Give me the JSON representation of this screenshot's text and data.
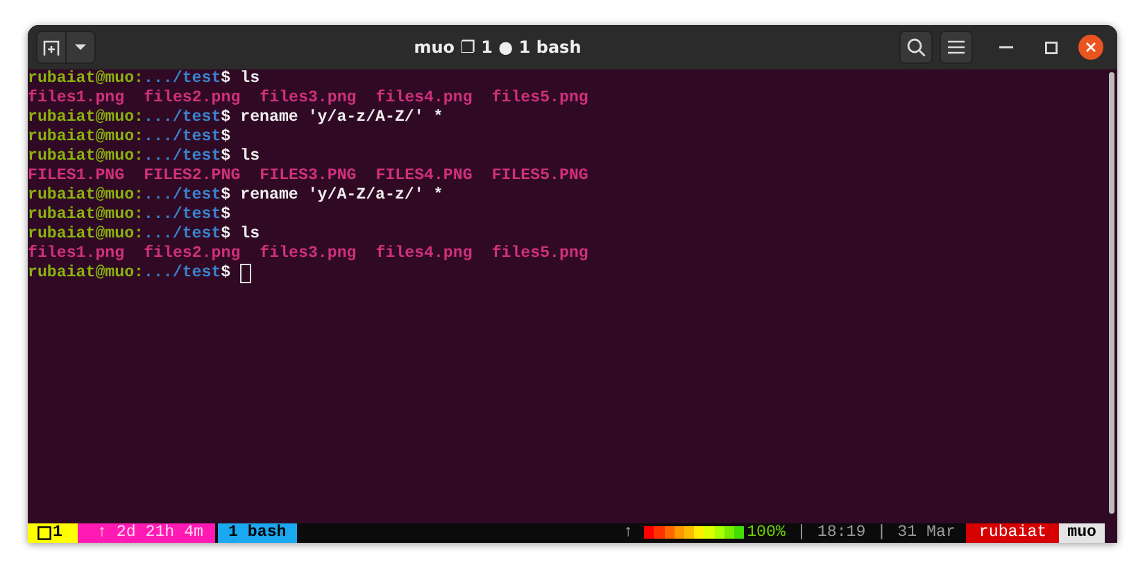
{
  "window": {
    "title": "muo ❐ 1 ● 1 bash"
  },
  "terminal": {
    "lines": [
      {
        "kind": "prompt",
        "user": "rubaiat@muo",
        "sep": ":",
        "path": ".../test",
        "symbol": "$",
        "command": "ls"
      },
      {
        "kind": "output",
        "files": [
          "files1.png",
          "files2.png",
          "files3.png",
          "files4.png",
          "files5.png"
        ]
      },
      {
        "kind": "prompt",
        "user": "rubaiat@muo",
        "sep": ":",
        "path": ".../test",
        "symbol": "$",
        "command": "rename 'y/a-z/A-Z/' *"
      },
      {
        "kind": "prompt",
        "user": "rubaiat@muo",
        "sep": ":",
        "path": ".../test",
        "symbol": "$"
      },
      {
        "kind": "prompt",
        "user": "rubaiat@muo",
        "sep": ":",
        "path": ".../test",
        "symbol": "$",
        "command": "ls"
      },
      {
        "kind": "output",
        "files": [
          "FILES1.PNG",
          "FILES2.PNG",
          "FILES3.PNG",
          "FILES4.PNG",
          "FILES5.PNG"
        ]
      },
      {
        "kind": "prompt",
        "user": "rubaiat@muo",
        "sep": ":",
        "path": ".../test",
        "symbol": "$",
        "command": "rename 'y/A-Z/a-z/' *"
      },
      {
        "kind": "prompt",
        "user": "rubaiat@muo",
        "sep": ":",
        "path": ".../test",
        "symbol": "$"
      },
      {
        "kind": "prompt",
        "user": "rubaiat@muo",
        "sep": ":",
        "path": ".../test",
        "symbol": "$",
        "command": "ls"
      },
      {
        "kind": "output",
        "files": [
          "files1.png",
          "files2.png",
          "files3.png",
          "files4.png",
          "files5.png"
        ]
      },
      {
        "kind": "prompt",
        "user": "rubaiat@muo",
        "sep": ":",
        "path": ".../test",
        "symbol": "$",
        "cursor": true
      }
    ]
  },
  "status_bar": {
    "session": "1",
    "uptime": "↑ 2d 21h 4m",
    "windows": [
      {
        "label": "1 bash",
        "selected": true
      }
    ],
    "arrow": "↑",
    "battery": {
      "reading": "100%"
    },
    "separator_1": "|",
    "time": "18:19",
    "separator_2": "|",
    "date": "31 Mar",
    "user": "rubaiat",
    "host": "muo"
  }
}
